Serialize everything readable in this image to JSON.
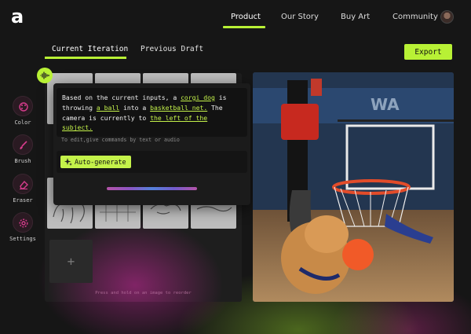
{
  "brand": {
    "logo_text": "a"
  },
  "nav": {
    "items": [
      {
        "label": "Product",
        "active": true
      },
      {
        "label": "Our Story"
      },
      {
        "label": "Buy Art"
      },
      {
        "label": "Community"
      }
    ],
    "accent_color": "#b8f135"
  },
  "tabs": [
    {
      "label": "Current Iteration",
      "active": true
    },
    {
      "label": "Previous Draft"
    }
  ],
  "toolbar": {
    "export_label": "Export"
  },
  "tools": [
    {
      "label": "Color",
      "icon": "palette-icon"
    },
    {
      "label": "Brush",
      "icon": "brush-icon"
    },
    {
      "label": "Eraser",
      "icon": "eraser-icon"
    },
    {
      "label": "Settings",
      "icon": "gear-icon"
    }
  ],
  "ai_panel": {
    "description_parts": [
      "Based on the current inputs, a ",
      "corgi dog",
      " is throwing ",
      "a ball",
      " into a ",
      "basketball net.",
      " The camera is currently to ",
      "the left of the subject.",
      ""
    ],
    "edit_hint": "To edit,give commands by text or audio",
    "generate_label": "Auto-generate"
  },
  "gallery": {
    "add_symbol": "+",
    "hint": "Press and hold on an image to reorder"
  },
  "video": {
    "sign_text": "WA"
  }
}
